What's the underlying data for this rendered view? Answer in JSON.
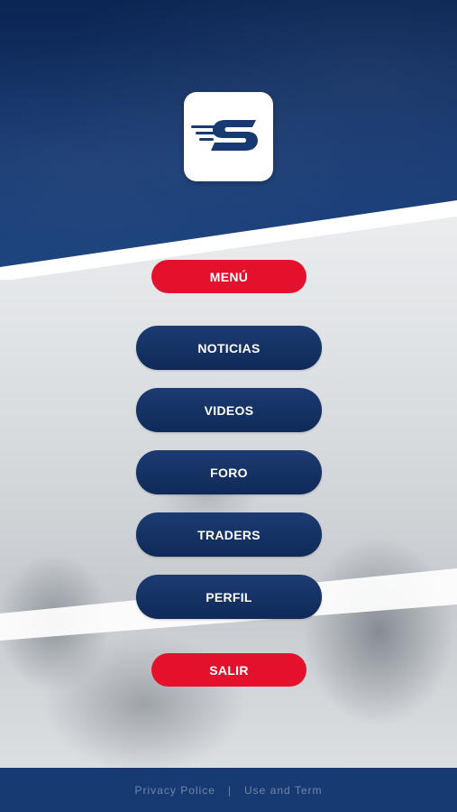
{
  "brand": {
    "logo_icon": "s-speed-logo-icon",
    "colors": {
      "navy": "#173a73",
      "red": "#e4112c",
      "white": "#ffffff"
    }
  },
  "menu": {
    "header_button": "MENÚ",
    "items": [
      {
        "label": "NOTICIAS"
      },
      {
        "label": "VIDEOS"
      },
      {
        "label": "FORO"
      },
      {
        "label": "TRADERS"
      },
      {
        "label": "PERFIL"
      }
    ],
    "exit_button": "SALIR"
  },
  "footer": {
    "privacy_link": "Privacy Police",
    "separator": "|",
    "terms_link": "Use and Term"
  }
}
